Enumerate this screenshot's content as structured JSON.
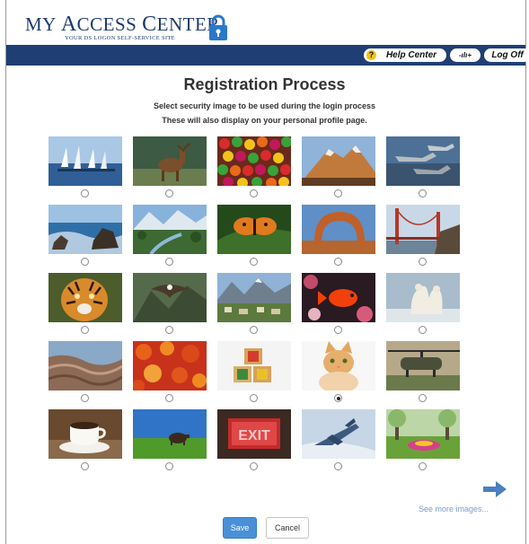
{
  "header": {
    "logo_title_prefix": "MY ",
    "logo_title_a": "A",
    "logo_title_ccess": "CCESS ",
    "logo_title_c": "C",
    "logo_title_enter": "ENTER",
    "logo_subtitle": "YOUR DS LOGON SELF-SERVICE SITE"
  },
  "nav": {
    "help_label": "Help Center",
    "help_icon": "question-icon",
    "access_label": "-ılı+",
    "logoff_label": "Log Off"
  },
  "page": {
    "title": "Registration Process",
    "instruction_1": "Select security image to be used during the login process",
    "instruction_2": "These will also display on your personal profile page."
  },
  "images": [
    {
      "name": "sailboats",
      "selected": false
    },
    {
      "name": "deer",
      "selected": false
    },
    {
      "name": "candy",
      "selected": false
    },
    {
      "name": "mountain",
      "selected": false
    },
    {
      "name": "jets",
      "selected": false
    },
    {
      "name": "ocean-rocks",
      "selected": false
    },
    {
      "name": "valley",
      "selected": false
    },
    {
      "name": "butterfly",
      "selected": false
    },
    {
      "name": "rock-arch",
      "selected": false
    },
    {
      "name": "bridge",
      "selected": false
    },
    {
      "name": "tiger",
      "selected": false
    },
    {
      "name": "eagle",
      "selected": false
    },
    {
      "name": "town-mountains",
      "selected": false
    },
    {
      "name": "fish",
      "selected": false
    },
    {
      "name": "polar-bears",
      "selected": false
    },
    {
      "name": "desert-canyon",
      "selected": false
    },
    {
      "name": "autumn-leaves",
      "selected": false
    },
    {
      "name": "abc-blocks",
      "selected": false
    },
    {
      "name": "kitten",
      "selected": true
    },
    {
      "name": "helicopter",
      "selected": false
    },
    {
      "name": "coffee-cup",
      "selected": false
    },
    {
      "name": "cow-field",
      "selected": false
    },
    {
      "name": "exit-sign",
      "selected": false
    },
    {
      "name": "fighter-jet",
      "selected": false
    },
    {
      "name": "garden",
      "selected": false
    }
  ],
  "more": {
    "label": "See more images...",
    "icon": "arrow-right-icon"
  },
  "buttons": {
    "save": "Save",
    "cancel": "Cancel"
  },
  "colors": {
    "navbar": "#1f3f74",
    "brand_text": "#1d3a6e",
    "save_button": "#4a90d9",
    "link": "#7a9fc8",
    "help_badge": "#f0c419"
  }
}
